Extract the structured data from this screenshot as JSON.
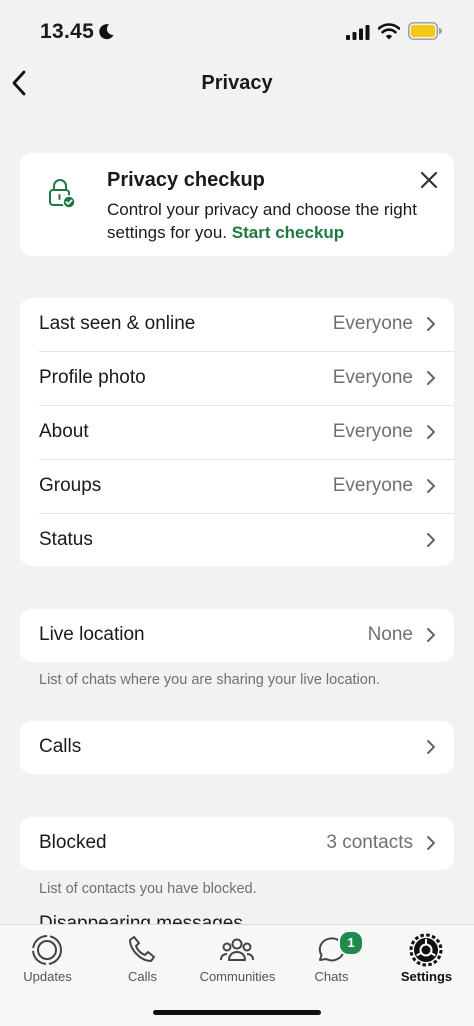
{
  "status_bar": {
    "time": "13.45"
  },
  "nav": {
    "title": "Privacy"
  },
  "checkup": {
    "title": "Privacy checkup",
    "description": "Control your privacy and choose the right settings for you.",
    "link": "Start checkup"
  },
  "privacy_items": [
    {
      "label": "Last seen & online",
      "value": "Everyone"
    },
    {
      "label": "Profile photo",
      "value": "Everyone"
    },
    {
      "label": "About",
      "value": "Everyone"
    },
    {
      "label": "Groups",
      "value": "Everyone"
    },
    {
      "label": "Status",
      "value": ""
    }
  ],
  "live_location": {
    "label": "Live location",
    "value": "None",
    "footer": "List of chats where you are sharing your live location."
  },
  "calls": {
    "label": "Calls"
  },
  "blocked": {
    "label": "Blocked",
    "value": "3 contacts",
    "footer": "List of contacts you have blocked."
  },
  "partial_next": "Disappearing messages",
  "tabs": [
    {
      "label": "Updates",
      "icon": "updates-icon"
    },
    {
      "label": "Calls",
      "icon": "phone-icon"
    },
    {
      "label": "Communities",
      "icon": "communities-icon"
    },
    {
      "label": "Chats",
      "icon": "chats-icon",
      "badge": "1"
    },
    {
      "label": "Settings",
      "icon": "settings-gear-icon",
      "active": true
    }
  ],
  "colors": {
    "accent": "#1f7a41",
    "badge": "#1f8a4c",
    "background": "#f2f2f2"
  }
}
